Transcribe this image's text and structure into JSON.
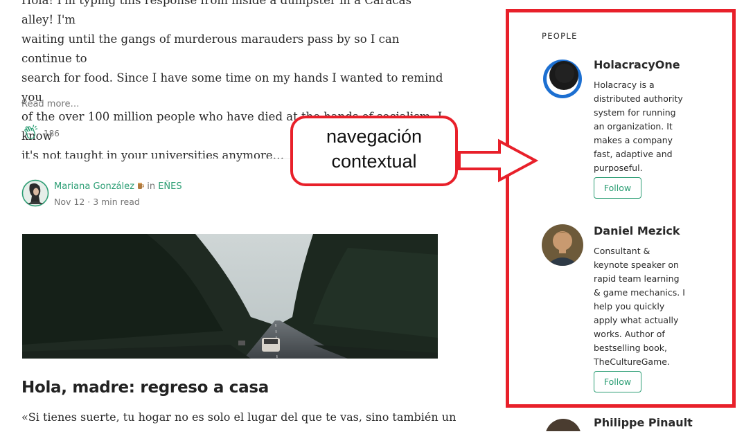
{
  "feed": {
    "excerpt_lines": [
      "Hola! I'm typing this response from inside a dumpster in a Caracas alley! I'm",
      "waiting until the gangs of murderous marauders pass by so I can continue to",
      "search for food. Since I have some time on my hands I wanted to remind you",
      "of the over 100 million people who have died at the hands of socialism. I know",
      "it's not taught in your universities anymore…"
    ],
    "read_more": "Read more…",
    "clap_count": "186",
    "author": "Mariana González",
    "in_word": "in",
    "publication": "EÑES",
    "date_line": "Nov 12 · 3 min read",
    "post_title": "Hola, madre: regreso a casa",
    "post_snippet": "«Si tienes suerte, tu hogar no es solo el lugar del que te vas, sino también un"
  },
  "annotation": {
    "callout_line1": "navegación",
    "callout_line2": "contextual",
    "color": "#e8202a"
  },
  "people": {
    "heading": "PEOPLE",
    "items": [
      {
        "name": "HolacracyOne",
        "bio": "Holacracy is a distributed authority system for running an organization. It makes a company fast, adaptive and purposeful.",
        "follow": "Follow",
        "icon": "holacracy-logo"
      },
      {
        "name": "Daniel Mezick",
        "bio": "Consultant & keynote speaker on rapid team learning & game mechanics. I help you quickly apply what actually works. Author of bestselling book, TheCultureGame.",
        "follow": "Follow",
        "icon": "person-photo"
      }
    ],
    "next_name": "Philippe Pinault"
  },
  "colors": {
    "accent": "#2a9d73",
    "annotation_red": "#e8202a",
    "text": "#292929",
    "muted": "#757575"
  }
}
